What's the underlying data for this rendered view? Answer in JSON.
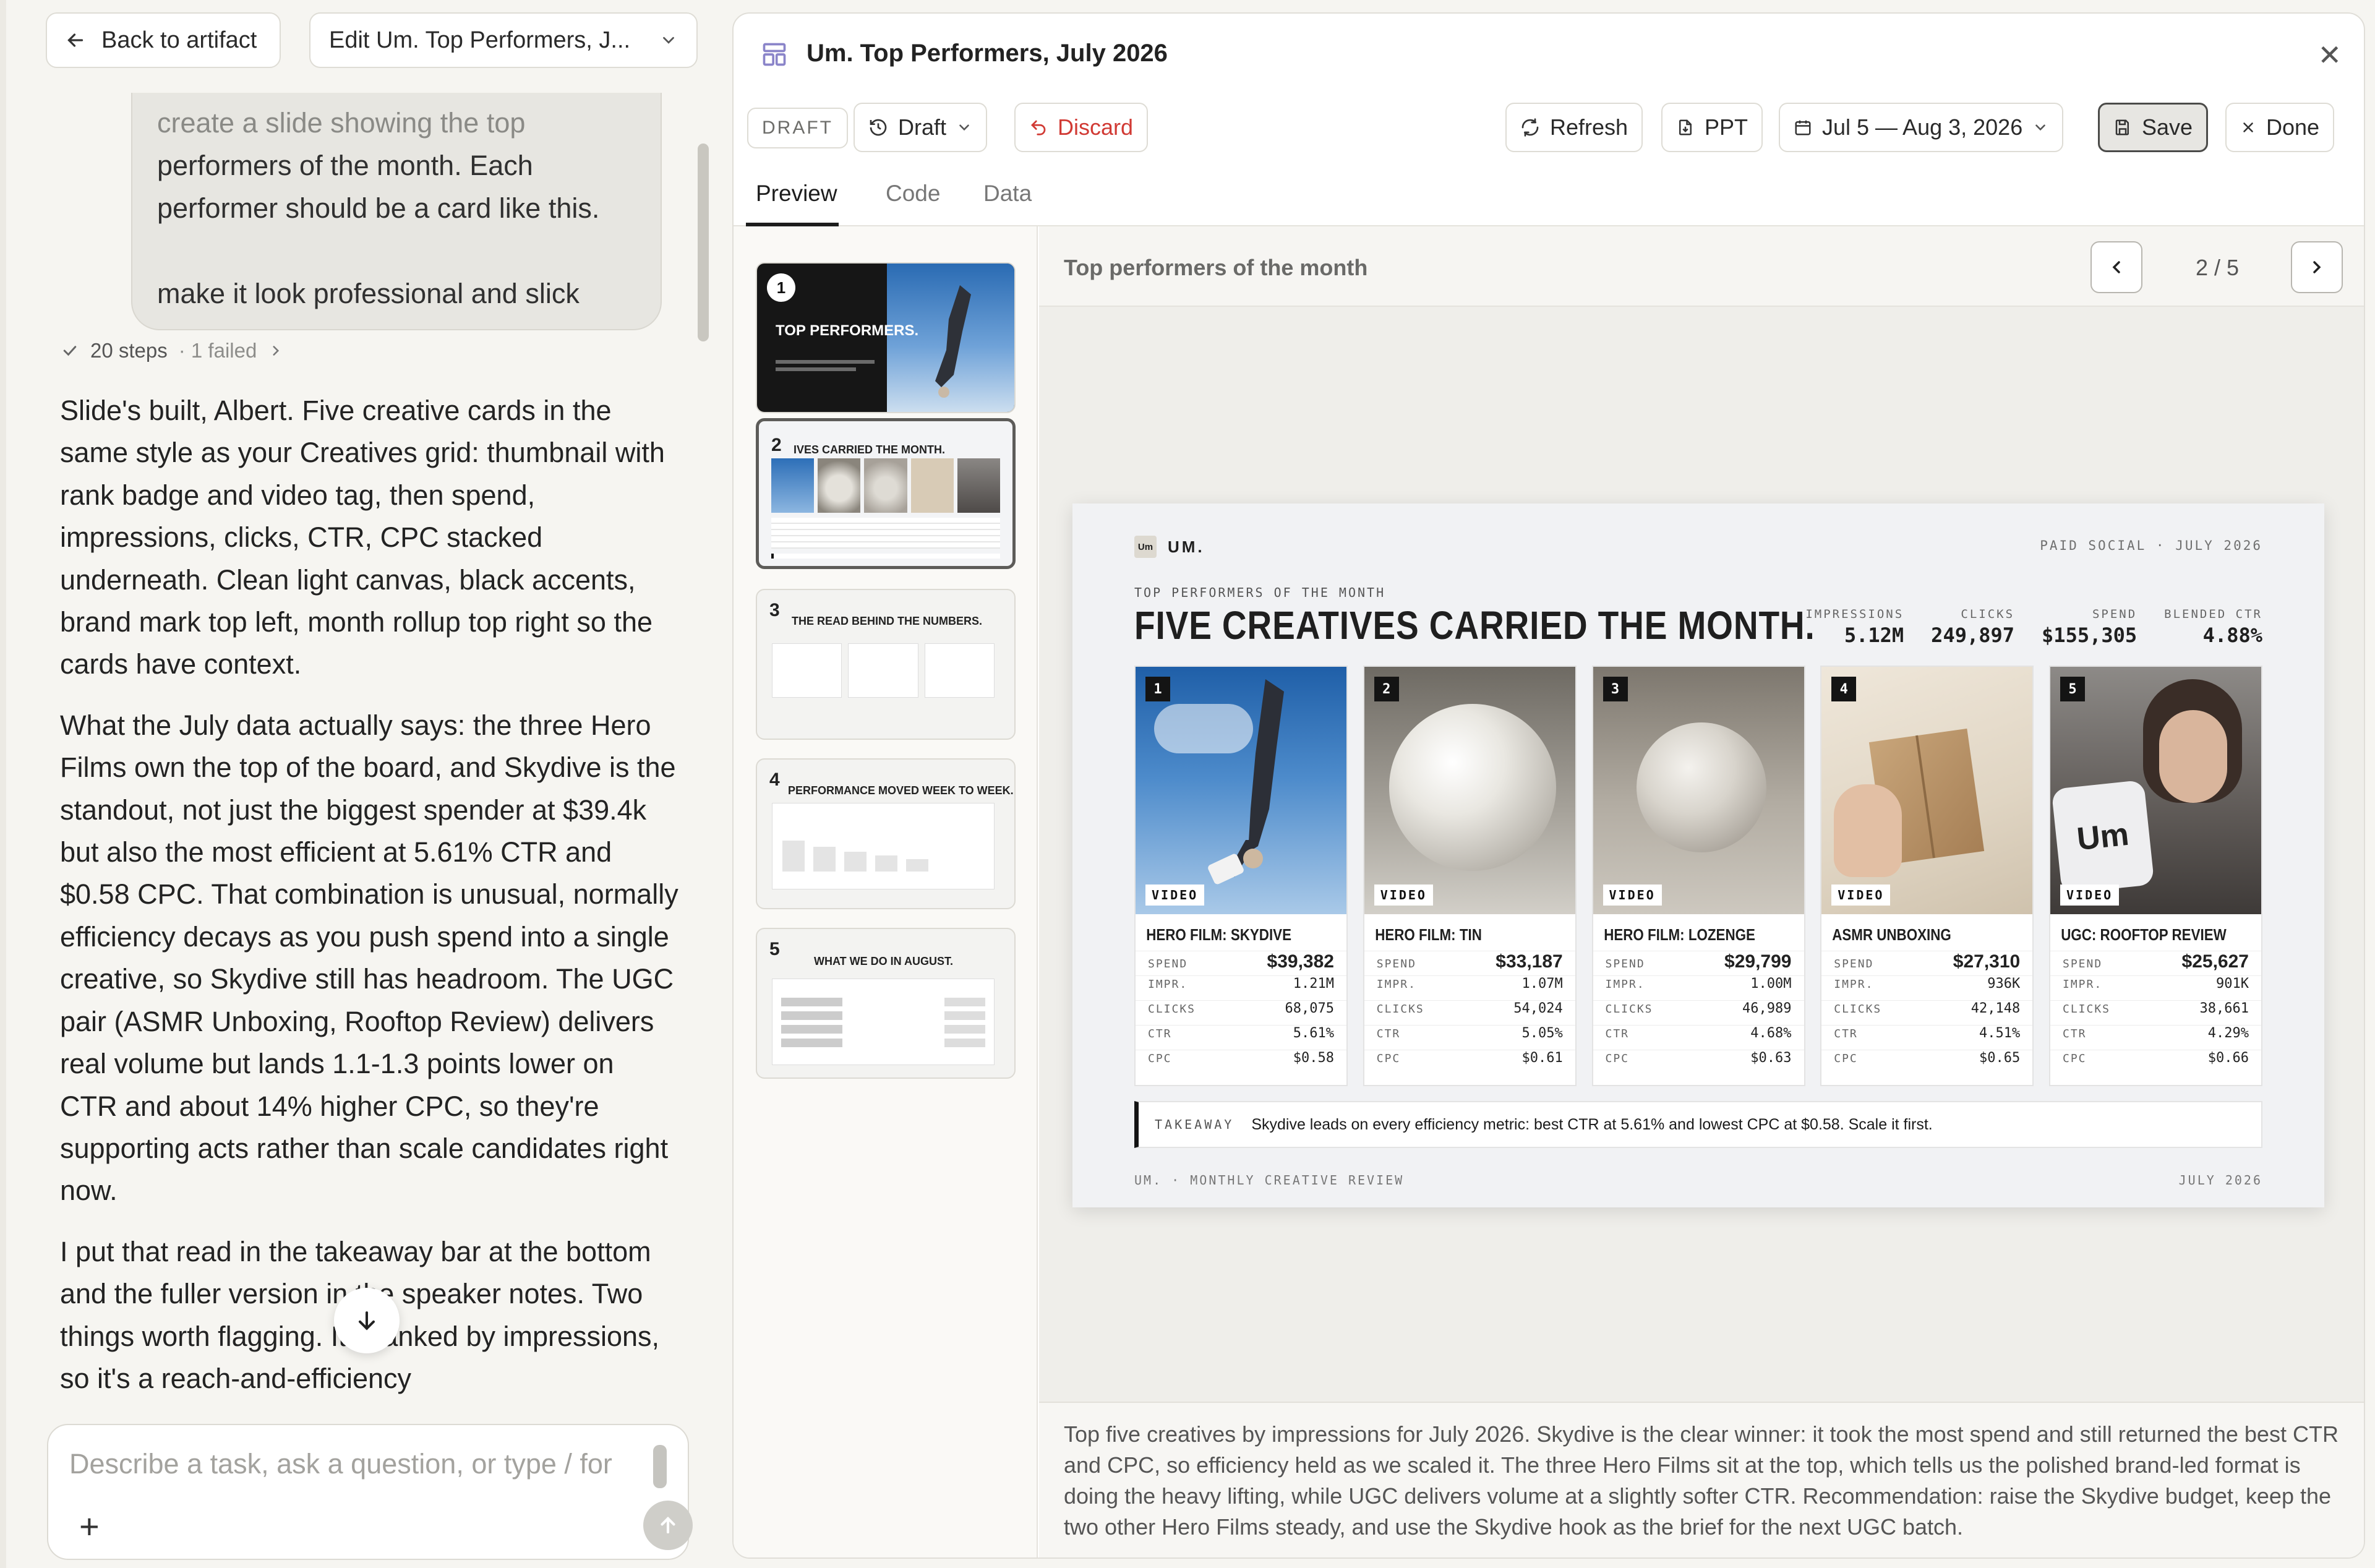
{
  "nav": {
    "back_label": "Back to artifact",
    "edit_label": "Edit Um. Top Performers, J..."
  },
  "chat": {
    "user_message": {
      "line1": "create a slide showing the top",
      "line2": "performers of the month. Each",
      "line3": "performer should be a card like this.",
      "line4": "make it look professional and slick"
    },
    "steps_label": "20 steps",
    "failed_label": "· 1 failed",
    "paragraphs": [
      "Slide's built, Albert. Five creative cards in the same style as your Creatives grid: thumbnail with rank badge and video tag, then spend, impressions, clicks, CTR, CPC stacked underneath. Clean light canvas, black accents, brand mark top left, month rollup top right so the cards have context.",
      "What the July data actually says: the three Hero Films own the top of the board, and Skydive is the standout, not just the biggest spender at $39.4k but also the most efficient at 5.61% CTR and $0.58 CPC. That combination is unusual, normally efficiency decays as you push spend into a single creative, so Skydive still has headroom. The UGC pair (ASMR Unboxing, Rooftop Review) delivers real volume but lands 1.1-1.3 points lower on CTR and about 14% higher CPC, so they're supporting acts rather than scale candidates right now.",
      "I put that read in the takeaway bar at the bottom and the fuller version in the speaker notes. Two things worth flagging. It's ranked by impressions, so it's a reach-and-efficiency"
    ],
    "composer_placeholder": "Describe a task, ask a question, or type / for"
  },
  "artifact": {
    "title": "Um. Top Performers, July 2026",
    "toolbar": {
      "status_tag": "DRAFT",
      "version_label": "Draft",
      "discard_label": "Discard",
      "refresh_label": "Refresh",
      "ppt_label": "PPT",
      "date_range": "Jul 5 — Aug 3, 2026",
      "save_label": "Save",
      "done_label": "Done"
    },
    "tabs": [
      "Preview",
      "Code",
      "Data"
    ],
    "thumbnails": [
      {
        "num": "1",
        "title": "TOP PERFORMERS."
      },
      {
        "num": "2",
        "title": "IVES CARRIED THE MONTH."
      },
      {
        "num": "3",
        "title": "THE READ BEHIND THE NUMBERS."
      },
      {
        "num": "4",
        "title": "PERFORMANCE MOVED WEEK TO WEEK."
      },
      {
        "num": "5",
        "title": "WHAT WE DO IN AUGUST."
      }
    ],
    "stage_title": "Top performers of the month",
    "page_counter": "2 / 5",
    "speaker_notes": "Top five creatives by impressions for July 2026. Skydive is the clear winner: it took the most spend and still returned the best CTR and CPC, so efficiency held as we scaled it. The three Hero Films sit at the top, which tells us the polished brand-led format is doing the heavy lifting, while UGC delivers volume at a slightly softer CTR. Recommendation: raise the Skydive budget, keep the two other Hero Films steady, and use the Skydive hook as the brief for the next UGC batch."
  },
  "slide": {
    "logo_text": "Um",
    "brand": "UM.",
    "rollup": "PAID SOCIAL · JULY 2026",
    "kicker": "TOP PERFORMERS OF THE MONTH",
    "headline": "FIVE CREATIVES CARRIED THE MONTH.",
    "metrics": [
      {
        "label": "IMPRESSIONS",
        "value": "5.12M"
      },
      {
        "label": "CLICKS",
        "value": "249,897"
      },
      {
        "label": "SPEND",
        "value": "$155,305"
      },
      {
        "label": "BLENDED CTR",
        "value": "4.88%"
      }
    ],
    "row_labels": {
      "spend": "SPEND",
      "impr": "IMPR.",
      "clicks": "CLICKS",
      "ctr": "CTR",
      "cpc": "CPC"
    },
    "video_tag": "VIDEO",
    "cards": [
      {
        "rank": "1",
        "name": "HERO FILM: SKYDIVE",
        "spend": "$39,382",
        "impr": "1.21M",
        "clicks": "68,075",
        "ctr": "5.61%",
        "cpc": "$0.58"
      },
      {
        "rank": "2",
        "name": "HERO FILM: TIN",
        "spend": "$33,187",
        "impr": "1.07M",
        "clicks": "54,024",
        "ctr": "5.05%",
        "cpc": "$0.61"
      },
      {
        "rank": "3",
        "name": "HERO FILM: LOZENGE",
        "spend": "$29,799",
        "impr": "1.00M",
        "clicks": "46,989",
        "ctr": "4.68%",
        "cpc": "$0.63"
      },
      {
        "rank": "4",
        "name": "ASMR UNBOXING",
        "spend": "$27,310",
        "impr": "936K",
        "clicks": "42,148",
        "ctr": "4.51%",
        "cpc": "$0.65"
      },
      {
        "rank": "5",
        "name": "UGC: ROOFTOP REVIEW",
        "spend": "$25,627",
        "impr": "901K",
        "clicks": "38,661",
        "ctr": "4.29%",
        "cpc": "$0.66"
      }
    ],
    "takeaway_label": "TAKEAWAY",
    "takeaway_text": "Skydive leads on every efficiency metric: best CTR at 5.61% and lowest CPC at $0.58. Scale it first.",
    "footer_left": "UM. · MONTHLY CREATIVE REVIEW",
    "footer_right": "JULY 2026"
  }
}
